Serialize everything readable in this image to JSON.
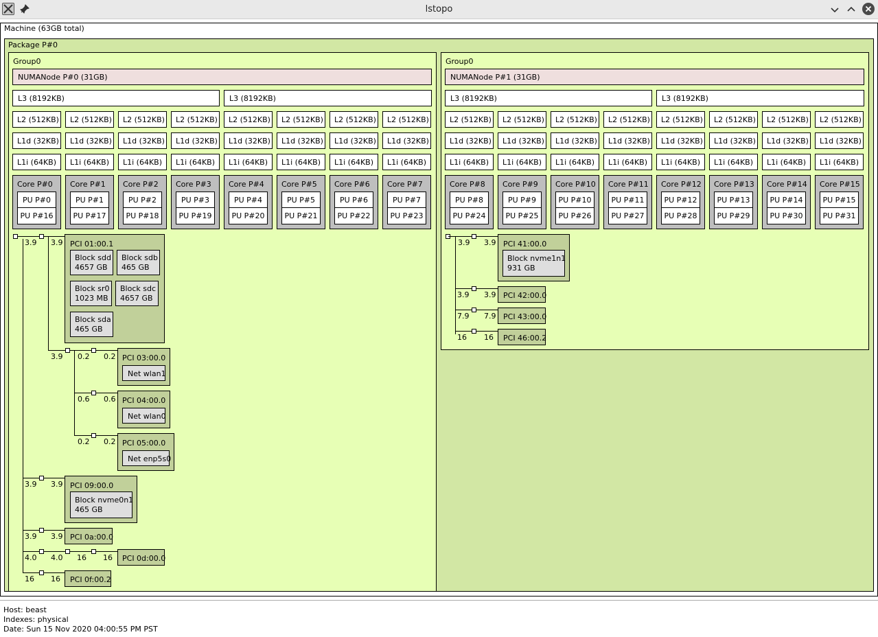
{
  "window": {
    "title": "lstopo"
  },
  "machine": {
    "label": "Machine (63GB total)"
  },
  "package": {
    "label": "Package P#0"
  },
  "groups": [
    {
      "label": "Group0",
      "numa": "NUMANode P#0 (31GB)",
      "l3": [
        "L3 (8192KB)",
        "L3 (8192KB)"
      ],
      "l2": [
        "L2 (512KB)",
        "L2 (512KB)",
        "L2 (512KB)",
        "L2 (512KB)",
        "L2 (512KB)",
        "L2 (512KB)",
        "L2 (512KB)",
        "L2 (512KB)"
      ],
      "l1d": [
        "L1d (32KB)",
        "L1d (32KB)",
        "L1d (32KB)",
        "L1d (32KB)",
        "L1d (32KB)",
        "L1d (32KB)",
        "L1d (32KB)",
        "L1d (32KB)"
      ],
      "l1i": [
        "L1i (64KB)",
        "L1i (64KB)",
        "L1i (64KB)",
        "L1i (64KB)",
        "L1i (64KB)",
        "L1i (64KB)",
        "L1i (64KB)",
        "L1i (64KB)"
      ],
      "cores": [
        {
          "label": "Core P#0",
          "pus": [
            "PU P#0",
            "PU P#16"
          ]
        },
        {
          "label": "Core P#1",
          "pus": [
            "PU P#1",
            "PU P#17"
          ]
        },
        {
          "label": "Core P#2",
          "pus": [
            "PU P#2",
            "PU P#18"
          ]
        },
        {
          "label": "Core P#3",
          "pus": [
            "PU P#3",
            "PU P#19"
          ]
        },
        {
          "label": "Core P#4",
          "pus": [
            "PU P#4",
            "PU P#20"
          ]
        },
        {
          "label": "Core P#5",
          "pus": [
            "PU P#5",
            "PU P#21"
          ]
        },
        {
          "label": "Core P#6",
          "pus": [
            "PU P#6",
            "PU P#22"
          ]
        },
        {
          "label": "Core P#7",
          "pus": [
            "PU P#7",
            "PU P#23"
          ]
        }
      ]
    },
    {
      "label": "Group0",
      "numa": "NUMANode P#1 (31GB)",
      "l3": [
        "L3 (8192KB)",
        "L3 (8192KB)"
      ],
      "l2": [
        "L2 (512KB)",
        "L2 (512KB)",
        "L2 (512KB)",
        "L2 (512KB)",
        "L2 (512KB)",
        "L2 (512KB)",
        "L2 (512KB)",
        "L2 (512KB)"
      ],
      "l1d": [
        "L1d (32KB)",
        "L1d (32KB)",
        "L1d (32KB)",
        "L1d (32KB)",
        "L1d (32KB)",
        "L1d (32KB)",
        "L1d (32KB)",
        "L1d (32KB)"
      ],
      "l1i": [
        "L1i (64KB)",
        "L1i (64KB)",
        "L1i (64KB)",
        "L1i (64KB)",
        "L1i (64KB)",
        "L1i (64KB)",
        "L1i (64KB)",
        "L1i (64KB)"
      ],
      "cores": [
        {
          "label": "Core P#8",
          "pus": [
            "PU P#8",
            "PU P#24"
          ]
        },
        {
          "label": "Core P#9",
          "pus": [
            "PU P#9",
            "PU P#25"
          ]
        },
        {
          "label": "Core P#10",
          "pus": [
            "PU P#10",
            "PU P#26"
          ]
        },
        {
          "label": "Core P#11",
          "pus": [
            "PU P#11",
            "PU P#27"
          ]
        },
        {
          "label": "Core P#12",
          "pus": [
            "PU P#12",
            "PU P#28"
          ]
        },
        {
          "label": "Core P#13",
          "pus": [
            "PU P#13",
            "PU P#29"
          ]
        },
        {
          "label": "Core P#14",
          "pus": [
            "PU P#14",
            "PU P#30"
          ]
        },
        {
          "label": "Core P#15",
          "pus": [
            "PU P#15",
            "PU P#31"
          ]
        }
      ]
    }
  ],
  "pci0": {
    "p01": {
      "label": "PCI 01:00.1",
      "link_a": "3.9",
      "link_b": "3.9",
      "devs": [
        [
          "Block sdd",
          "4657 GB"
        ],
        [
          "Block sdb",
          "465 GB"
        ],
        [
          "Block sr0",
          "1023 MB"
        ],
        [
          "Block sdc",
          "4657 GB"
        ],
        [
          "Block sda",
          "465 GB"
        ]
      ]
    },
    "bridge2": {
      "link": "3.9"
    },
    "p03": {
      "label": "PCI 03:00.0",
      "link_a": "0.2",
      "link_b": "0.2",
      "dev": "Net wlan1"
    },
    "p04": {
      "label": "PCI 04:00.0",
      "link_a": "0.6",
      "link_b": "0.6",
      "dev": "Net wlan0"
    },
    "p05": {
      "label": "PCI 05:00.0",
      "link_a": "0.2",
      "link_b": "0.2",
      "dev": "Net enp5s0"
    },
    "p09": {
      "label": "PCI 09:00.0",
      "link_a": "3.9",
      "link_b": "3.9",
      "dev": [
        "Block nvme0n1",
        "465 GB"
      ]
    },
    "p0a": {
      "label": "PCI 0a:00.0",
      "link_a": "3.9",
      "link_b": "3.9"
    },
    "p0d": {
      "label": "PCI 0d:00.0",
      "link_a": "4.0",
      "link_b": "4.0",
      "link_c": "16",
      "link_d": "16"
    },
    "p0f": {
      "label": "PCI 0f:00.2",
      "link_a": "16",
      "link_b": "16"
    }
  },
  "pci1": {
    "p41": {
      "label": "PCI 41:00.0",
      "link_a": "3.9",
      "link_b": "3.9",
      "dev": [
        "Block nvme1n1",
        "931 GB"
      ]
    },
    "p42": {
      "label": "PCI 42:00.0",
      "link_a": "3.9",
      "link_b": "3.9"
    },
    "p43": {
      "label": "PCI 43:00.0",
      "link_a": "7.9",
      "link_b": "7.9"
    },
    "p46": {
      "label": "PCI 46:00.2",
      "link_a": "16",
      "link_b": "16"
    }
  },
  "footer": {
    "host": "Host: beast",
    "indexes": "Indexes: physical",
    "date": "Date: Sun 15 Nov 2020 04:00:55 PM PST"
  }
}
